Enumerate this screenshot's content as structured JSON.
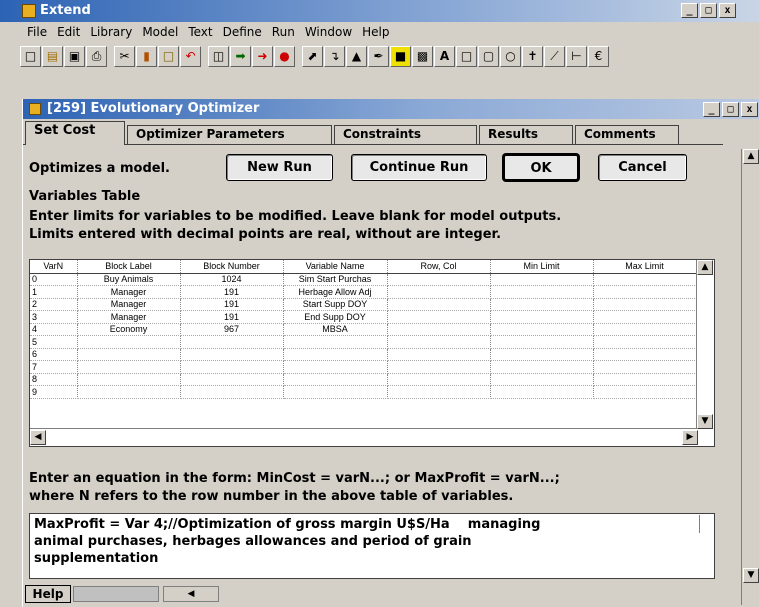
{
  "app": {
    "title": "Extend",
    "win_min": "_",
    "win_max": "□",
    "win_close": "x"
  },
  "menu": [
    "File",
    "Edit",
    "Library",
    "Model",
    "Text",
    "Define",
    "Run",
    "Window",
    "Help"
  ],
  "toolbar": [
    "new-icon",
    "open-icon",
    "save-icon",
    "print-icon",
    "cut-icon",
    "copy-icon",
    "paste-icon",
    "undo-icon",
    "hierarchy-icon",
    "connect-icon",
    "run-icon",
    "stop-icon",
    "pointer-icon",
    "connector-icon",
    "clone-icon",
    "brush-icon",
    "color-icon",
    "pattern-icon",
    "text-icon",
    "rect-icon",
    "round-rect-icon",
    "oval-icon",
    "polygon-icon",
    "line-icon",
    "ruler-icon",
    "zoom-icon"
  ],
  "dialog": {
    "title": "[259]  Evolutionary Optimizer",
    "tabs": [
      "Set Cost",
      "Optimizer Parameters",
      "Constraints",
      "Results",
      "Comments"
    ],
    "optimizes_label": "Optimizes a model.",
    "buttons": {
      "new_run": "New Run",
      "continue_run": "Continue Run",
      "ok": "OK",
      "cancel": "Cancel"
    },
    "variables_title": "Variables Table",
    "variables_help1": "Enter limits for variables to be modified. Leave blank for model outputs.",
    "variables_help2": "Limits entered with decimal points are real, without are integer.",
    "table": {
      "columns": [
        "VarN",
        "Block Label",
        "Block Number",
        "Variable Name",
        "Row, Col",
        "Min Limit",
        "Max Limit"
      ],
      "rows": [
        [
          "0",
          "Buy Animals",
          "1024",
          "Sim Start Purchas",
          "",
          "",
          ""
        ],
        [
          "1",
          "Manager",
          "191",
          "Herbage Allow Adj",
          "",
          "",
          ""
        ],
        [
          "2",
          "Manager",
          "191",
          "Start Supp DOY",
          "",
          "",
          ""
        ],
        [
          "3",
          "Manager",
          "191",
          "End Supp DOY",
          "",
          "",
          ""
        ],
        [
          "4",
          "Economy",
          "967",
          "MBSA",
          "",
          "",
          ""
        ],
        [
          "5",
          "",
          "",
          "",
          "",
          "",
          ""
        ],
        [
          "6",
          "",
          "",
          "",
          "",
          "",
          ""
        ],
        [
          "7",
          "",
          "",
          "",
          "",
          "",
          ""
        ],
        [
          "8",
          "",
          "",
          "",
          "",
          "",
          ""
        ],
        [
          "9",
          "",
          "",
          "",
          "",
          "",
          ""
        ]
      ]
    },
    "equation_help1": "Enter an equation in the form: MinCost = varN...; or MaxProfit = varN...;",
    "equation_help2": "where N refers to the row number in the above table of variables.",
    "equation_text": "MaxProfit = Var 4;//Optimization of gross margin U$S/Ha    managing\nanimal purchases, herbages allowances and period of grain\nsupplementation",
    "help_label": "Help"
  }
}
